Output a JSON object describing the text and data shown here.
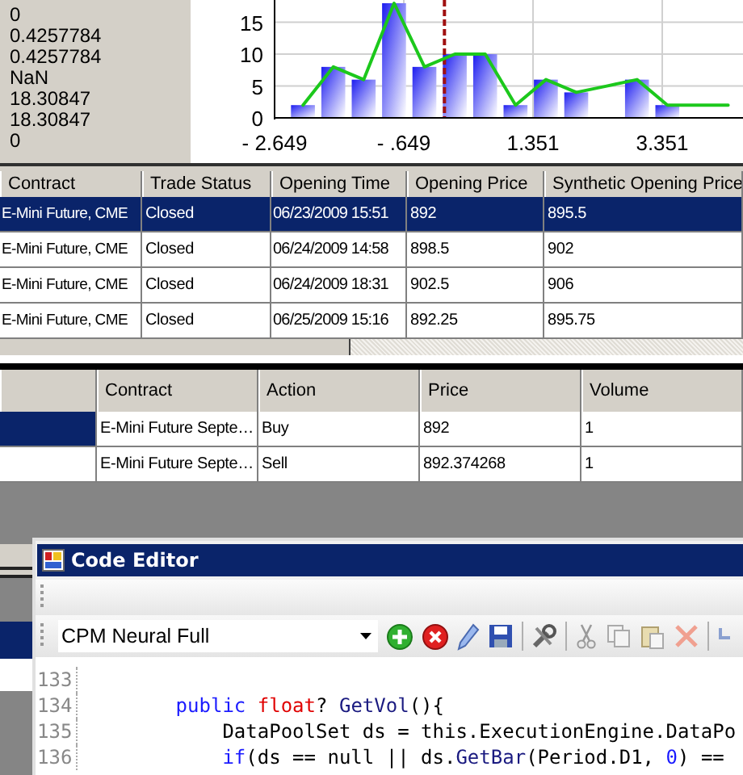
{
  "statistics_panel": {
    "values": [
      "0",
      "0.4257784",
      "0.4257784",
      "NaN",
      "18.30847",
      "18.30847",
      "0"
    ]
  },
  "histogram": {
    "chart_data": {
      "type": "bar",
      "x": [
        -2.21,
        -1.74,
        -1.27,
        -0.8,
        -0.33,
        0.14,
        0.61,
        1.08,
        1.55,
        2.02,
        2.96,
        3.43
      ],
      "series": [
        {
          "color": "#1c1cf0",
          "values": [
            2,
            8,
            6,
            18,
            8,
            10,
            10,
            2,
            6,
            4,
            6,
            2
          ]
        }
      ],
      "xlim": [
        -2.649,
        4.601
      ],
      "ylim": [
        0,
        18.5
      ],
      "grid": true,
      "xticks": [
        {
          "value": -2.649,
          "label": "- 2.649"
        },
        {
          "value": -0.649,
          "label": "- .649"
        },
        {
          "value": 1.351,
          "label": "1.351"
        },
        {
          "value": 3.351,
          "label": "3.351"
        }
      ],
      "yticks": [
        0,
        5,
        10,
        15
      ],
      "ref_lines": [
        {
          "axis": "x",
          "value": -0.02,
          "color": "#a01010"
        }
      ]
    }
  },
  "curve": {
    "chart_data": {
      "type": "line",
      "x": [
        -2.21,
        -1.74,
        -1.27,
        -0.8,
        -0.33,
        0.14,
        0.61,
        1.08,
        1.55,
        2.02,
        2.49,
        2.96,
        3.43,
        3.9,
        4.37
      ],
      "series": [
        {
          "color": "#1cc81c",
          "values": [
            2,
            8,
            6,
            18,
            8,
            10,
            10,
            2,
            6,
            4,
            5,
            6,
            2,
            2,
            2
          ]
        }
      ],
      "xlim": [
        -2.649,
        4.601
      ],
      "ylim": [
        0,
        18.5
      ]
    }
  },
  "trades_table": {
    "columns": [
      "Contract",
      "Trade Status",
      "Opening Time",
      "Opening Price",
      "Synthetic Opening Price"
    ],
    "rows": [
      {
        "selected": true,
        "cells": [
          "E-Mini Future, CME",
          "Closed",
          "06/23/2009 15:51",
          "892",
          "895.5"
        ]
      },
      {
        "selected": false,
        "cells": [
          "E-Mini Future, CME",
          "Closed",
          "06/24/2009 14:58",
          "898.5",
          "902"
        ]
      },
      {
        "selected": false,
        "cells": [
          "E-Mini Future, CME",
          "Closed",
          "06/24/2009 18:31",
          "902.5",
          "906"
        ]
      },
      {
        "selected": false,
        "cells": [
          "E-Mini Future, CME",
          "Closed",
          "06/25/2009 15:16",
          "892.25",
          "895.75"
        ]
      }
    ]
  },
  "orders_table": {
    "columns": [
      "Contract",
      "Action",
      "Price",
      "Volume"
    ],
    "rows": [
      {
        "selected": true,
        "cells": [
          "E-Mini Future Septe…",
          "Buy",
          "892",
          "1"
        ]
      },
      {
        "selected": false,
        "cells": [
          "E-Mini Future Septe…",
          "Sell",
          "892.374268",
          "1"
        ]
      }
    ]
  },
  "code_editor": {
    "title": "Code Editor",
    "script_selector": {
      "value": "CPM Neural Full"
    },
    "code_lines": [
      {
        "number": "133"
      },
      {
        "number": "134",
        "tokens": [
          {
            "text": "        public",
            "kind": "keyword"
          },
          {
            "text": " float",
            "kind": "type"
          },
          {
            "text": "? ",
            "kind": "plain"
          },
          {
            "text": "GetVol",
            "kind": "method"
          },
          {
            "text": "(){",
            "kind": "plain"
          }
        ]
      },
      {
        "number": "135",
        "tokens": [
          {
            "text": "            DataPoolSet ds = this.ExecutionEngine.DataPo",
            "kind": "plain"
          }
        ]
      },
      {
        "number": "136",
        "tokens": [
          {
            "text": "            if",
            "kind": "keyword"
          },
          {
            "text": "(ds == null || ds.",
            "kind": "plain"
          },
          {
            "text": "GetBar",
            "kind": "method"
          },
          {
            "text": "(Period.D1, ",
            "kind": "plain"
          },
          {
            "text": "0",
            "kind": "number"
          },
          {
            "text": ") ==",
            "kind": "plain"
          }
        ]
      }
    ]
  }
}
